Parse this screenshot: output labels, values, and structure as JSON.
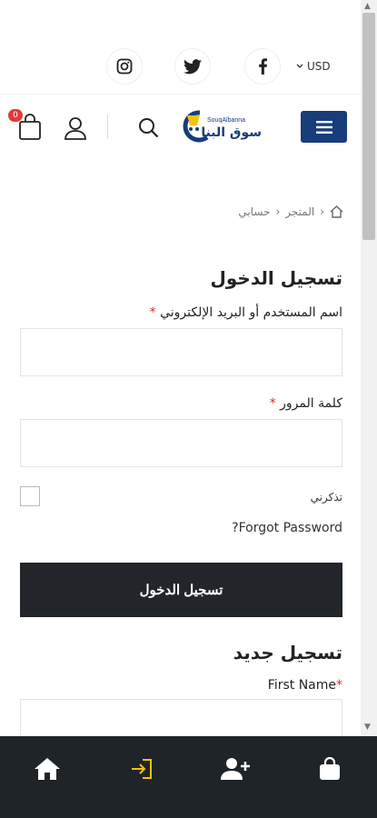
{
  "topbar": {
    "currency": "USD",
    "social": [
      "instagram-icon",
      "twitter-icon",
      "facebook-icon"
    ]
  },
  "header": {
    "cart_count": "0",
    "logo_text_en": "SouqAlbanna",
    "logo_text_ar": "سوق البنا",
    "brand_color": "#173d7a"
  },
  "breadcrumb": [
    "المتجر",
    "حسابي"
  ],
  "login": {
    "title": "تسجيل الدخول",
    "username_label": "اسم المستخدم أو البريد الإلكتروني",
    "password_label": "كلمة المرور",
    "remember_label": "تذكرني",
    "forgot_label": "Forgot Password?",
    "submit_label": "تسجيل الدخول"
  },
  "register": {
    "title": "تسجيل جديد",
    "first_name_label": "First Name"
  },
  "bottom_nav": [
    "home-icon",
    "login-icon",
    "add-user-icon",
    "shopping-bag-icon"
  ],
  "colors": {
    "accent": "#f4c20d",
    "dark": "#1f2429",
    "button": "#222529"
  }
}
